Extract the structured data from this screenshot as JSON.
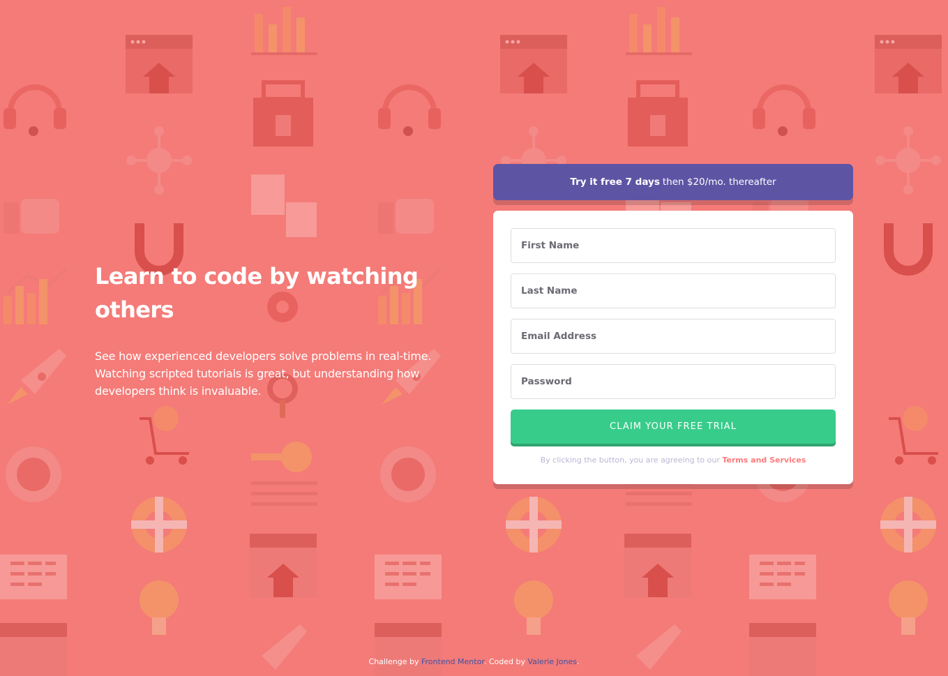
{
  "colors": {
    "background": "#f47b78",
    "promo_bg": "#5e54a4",
    "cta_bg": "#38cc8b",
    "terms_link": "#ff7a7a",
    "footer_link": "#3e52a3"
  },
  "hero": {
    "title": "Learn to code by watching others",
    "description": "See how experienced developers solve problems in real-time. Watching scripted tutorials is great, but understanding how developers think is invaluable."
  },
  "promo": {
    "bold": "Try it free 7 days",
    "rest": "then $20/mo. thereafter"
  },
  "form": {
    "first_name_placeholder": "First Name",
    "last_name_placeholder": "Last Name",
    "email_placeholder": "Email Address",
    "password_placeholder": "Password",
    "cta_label": "Claim your free trial",
    "terms_prefix": "By clicking the button, you are agreeing to our",
    "terms_link": "Terms and Services"
  },
  "footer": {
    "challenge_prefix": "Challenge by",
    "challenge_link": "Frontend Mentor",
    "coded_prefix": ". Coded by",
    "coded_link": "Valerie Jones",
    "suffix": "."
  }
}
